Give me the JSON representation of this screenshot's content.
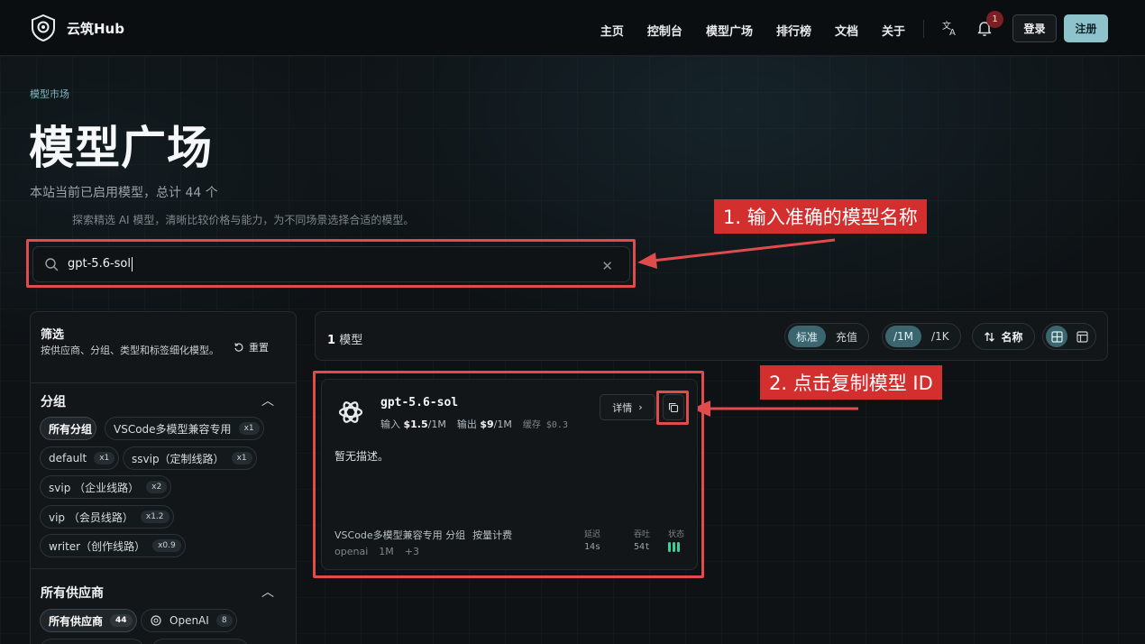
{
  "nav": {
    "brand": "云筑Hub",
    "links": [
      "主页",
      "控制台",
      "模型广场",
      "排行榜",
      "文档",
      "关于"
    ],
    "notification_count": "1",
    "login": "登录",
    "register": "注册"
  },
  "hero": {
    "breadcrumb": "模型市场",
    "title": "模型广场",
    "subtitle": "本站当前已启用模型，总计 44 个",
    "description": "探索精选 AI 模型，清晰比较价格与能力，为不同场景选择合适的模型。"
  },
  "search": {
    "value": "gpt-5.6-sol"
  },
  "annotations": {
    "step1": "1. 输入准确的模型名称",
    "step2": "2. 点击复制模型 ID"
  },
  "sidebar": {
    "title": "筛选",
    "description": "按供应商、分组、类型和标签细化模型。",
    "reset": "重置",
    "group_section": "分组",
    "groups": [
      {
        "label": "所有分组",
        "count": ""
      },
      {
        "label": "VSCode多模型兼容专用",
        "count": "x1"
      },
      {
        "label": "default",
        "count": "x1"
      },
      {
        "label": "ssvip（定制线路）",
        "count": "x1"
      },
      {
        "label": "svip （企业线路）",
        "count": "x2"
      },
      {
        "label": "vip （会员线路）",
        "count": "x1.2"
      },
      {
        "label": "writer（创作线路）",
        "count": "x0.9"
      }
    ],
    "vendor_section": "所有供应商",
    "vendors": [
      {
        "label": "所有供应商",
        "count": "44"
      },
      {
        "label": "OpenAI",
        "count": "8"
      }
    ]
  },
  "toolbar": {
    "count_num": "1",
    "count_label": "模型",
    "price_mode": [
      "标准",
      "充值"
    ],
    "unit": [
      "/1M",
      "/1K"
    ],
    "sort_label": "名称"
  },
  "card": {
    "name": "gpt-5.6-sol",
    "input_label": "输入",
    "input_price": "$1.5",
    "input_unit": "/1M",
    "output_label": "输出",
    "output_price": "$9",
    "output_unit": "/1M",
    "cache": "缓存 $0.3",
    "detail": "详情",
    "description": "暂无描述。",
    "group": "VSCode多模型兼容专用 分组",
    "billing": "按量计费",
    "vendor": "openai",
    "context": "1M",
    "more_tags": "+3",
    "latency_label": "延迟",
    "latency": "14s",
    "throughput_label": "吞吐",
    "throughput": "54t",
    "status_label": "状态"
  },
  "colors": {
    "accent": "#8ec3cc",
    "annotation": "#d42f2f",
    "status_ok": "#3ad29a"
  }
}
